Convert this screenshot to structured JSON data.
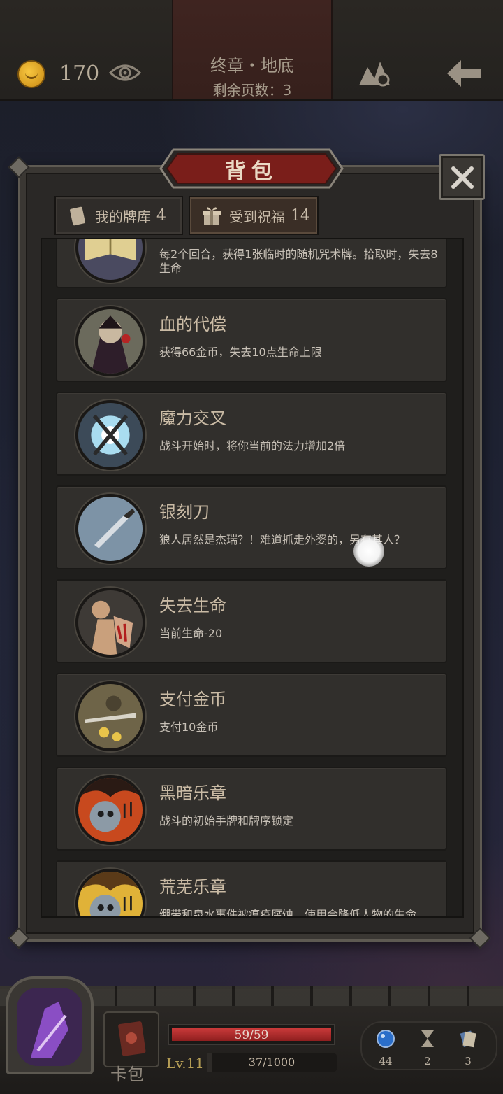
{
  "header": {
    "gold": "170",
    "chapter_title": "终章・地底",
    "pages_left": "剩余页数：3"
  },
  "panel": {
    "title": "背包",
    "tabs": [
      {
        "label": "我的牌库",
        "count": "4",
        "icon": "card-icon"
      },
      {
        "label": "受到祝福",
        "count": "14",
        "icon": "gift-icon"
      }
    ],
    "active_tab": 1
  },
  "items": [
    {
      "name": "",
      "desc": "每2个回合，获得1张临时的随机咒术牌。拾取时，失去8生命",
      "icon": "spellbook-portrait"
    },
    {
      "name": "血的代偿",
      "desc": "获得66金币，失去10点生命上限",
      "icon": "vampire-portrait"
    },
    {
      "name": "魔力交叉",
      "desc": "战斗开始时，将你当前的法力增加2倍",
      "icon": "crossed-staffs-portrait"
    },
    {
      "name": "银刻刀",
      "desc": "狼人居然是杰瑞？！难道抓走外婆的，另有其人？",
      "icon": "silver-knife-portrait"
    },
    {
      "name": "失去生命",
      "desc": "当前生命-20",
      "icon": "bleeding-arm-portrait"
    },
    {
      "name": "支付金币",
      "desc": "支付10金币",
      "icon": "pay-gold-portrait"
    },
    {
      "name": "黑暗乐章",
      "desc": "战斗的初始手牌和牌序锁定",
      "icon": "dark-music-portrait"
    },
    {
      "name": "荒芜乐章",
      "desc": "绷带和泉水事件被瘟疫腐蚀，使用会降低人物的生命",
      "icon": "barren-music-portrait"
    }
  ],
  "footer": {
    "deck_label": "卡包",
    "hp": "59/59",
    "hp_fraction": 1.0,
    "level": "Lv.11",
    "xp": "37/1000",
    "xp_fraction": 0.037,
    "resources": [
      {
        "icon": "mana-orb-icon",
        "value": "44"
      },
      {
        "icon": "hourglass-icon",
        "value": "2"
      },
      {
        "icon": "card-stack-icon",
        "value": "3"
      }
    ]
  },
  "colors": {
    "hp_red": "#c93a3a",
    "title_plate": "#7a1e1a",
    "gold": "#f7c640"
  }
}
